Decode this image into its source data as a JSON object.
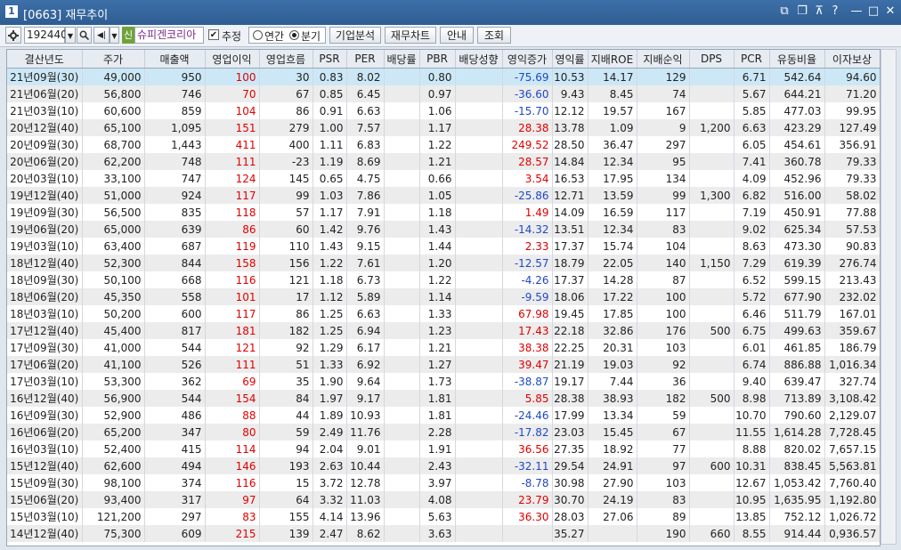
{
  "window": {
    "screen_no": "1",
    "title": "[0663] 재무추이",
    "controls": [
      "⧉",
      "❐",
      "⊼",
      "?",
      "—",
      "□",
      "✕"
    ]
  },
  "toolbar": {
    "code": "192440",
    "tag": "신",
    "company": "슈피겐코리아",
    "estimate_label": "추정",
    "estimate_checked": "✔",
    "radio_annual": "연간",
    "radio_quarter": "분기",
    "btn_company_analysis": "기업분석",
    "btn_fin_chart": "재무차트",
    "btn_guide": "안내",
    "btn_query": "조회"
  },
  "columns": [
    "결산년도",
    "주가",
    "매출액",
    "영업이익",
    "영업흐름",
    "PSR",
    "PER",
    "배당률",
    "PBR",
    "배당성향",
    "영익증가",
    "영익률",
    "지배ROE",
    "지배순익",
    "DPS",
    "PCR",
    "유동비율",
    "이자보상"
  ],
  "rows": [
    [
      "21년09월(30)",
      "49,000",
      "950",
      "100",
      "30",
      "0.83",
      "8.02",
      "",
      "0.80",
      "",
      "-75.69",
      "10.53",
      "14.17",
      "129",
      "",
      "6.71",
      "542.64",
      "94.60"
    ],
    [
      "21년06월(20)",
      "56,800",
      "746",
      "70",
      "67",
      "0.85",
      "6.45",
      "",
      "0.97",
      "",
      "-36.60",
      "9.43",
      "8.45",
      "74",
      "",
      "5.67",
      "644.21",
      "71.20"
    ],
    [
      "21년03월(10)",
      "60,600",
      "859",
      "104",
      "86",
      "0.91",
      "6.63",
      "",
      "1.06",
      "",
      "-15.70",
      "12.12",
      "19.57",
      "167",
      "",
      "5.85",
      "477.03",
      "99.95"
    ],
    [
      "20년12월(40)",
      "65,100",
      "1,095",
      "151",
      "279",
      "1.00",
      "7.57",
      "",
      "1.17",
      "",
      "28.38",
      "13.78",
      "1.09",
      "9",
      "1,200",
      "6.63",
      "423.29",
      "127.49"
    ],
    [
      "20년09월(30)",
      "68,700",
      "1,443",
      "411",
      "400",
      "1.11",
      "6.83",
      "",
      "1.22",
      "",
      "249.52",
      "28.50",
      "36.47",
      "297",
      "",
      "6.05",
      "454.61",
      "356.91"
    ],
    [
      "20년06월(20)",
      "62,200",
      "748",
      "111",
      "-23",
      "1.19",
      "8.69",
      "",
      "1.21",
      "",
      "28.57",
      "14.84",
      "12.34",
      "95",
      "",
      "7.41",
      "360.78",
      "79.33"
    ],
    [
      "20년03월(10)",
      "33,100",
      "747",
      "124",
      "145",
      "0.65",
      "4.75",
      "",
      "0.66",
      "",
      "3.54",
      "16.53",
      "17.95",
      "134",
      "",
      "4.09",
      "452.96",
      "79.33"
    ],
    [
      "19년12월(40)",
      "51,000",
      "924",
      "117",
      "99",
      "1.03",
      "7.86",
      "",
      "1.05",
      "",
      "-25.86",
      "12.71",
      "13.59",
      "99",
      "1,300",
      "6.82",
      "516.00",
      "58.02"
    ],
    [
      "19년09월(30)",
      "56,500",
      "835",
      "118",
      "57",
      "1.17",
      "7.91",
      "",
      "1.18",
      "",
      "1.49",
      "14.09",
      "16.59",
      "117",
      "",
      "7.19",
      "450.91",
      "77.88"
    ],
    [
      "19년06월(20)",
      "65,000",
      "639",
      "86",
      "60",
      "1.42",
      "9.76",
      "",
      "1.43",
      "",
      "-14.32",
      "13.51",
      "12.34",
      "83",
      "",
      "9.02",
      "625.34",
      "57.53"
    ],
    [
      "19년03월(10)",
      "63,400",
      "687",
      "119",
      "110",
      "1.43",
      "9.15",
      "",
      "1.44",
      "",
      "2.33",
      "17.37",
      "15.74",
      "104",
      "",
      "8.63",
      "473.30",
      "90.83"
    ],
    [
      "18년12월(40)",
      "52,300",
      "844",
      "158",
      "156",
      "1.22",
      "7.61",
      "",
      "1.20",
      "",
      "-12.57",
      "18.79",
      "22.05",
      "140",
      "1,150",
      "7.29",
      "619.39",
      "276.74"
    ],
    [
      "18년09월(30)",
      "50,100",
      "668",
      "116",
      "121",
      "1.18",
      "6.73",
      "",
      "1.22",
      "",
      "-4.26",
      "17.37",
      "14.28",
      "87",
      "",
      "6.52",
      "599.15",
      "213.43"
    ],
    [
      "18년06월(20)",
      "45,350",
      "558",
      "101",
      "17",
      "1.12",
      "5.89",
      "",
      "1.14",
      "",
      "-9.59",
      "18.06",
      "17.22",
      "100",
      "",
      "5.72",
      "677.90",
      "232.02"
    ],
    [
      "18년03월(10)",
      "50,200",
      "600",
      "117",
      "86",
      "1.25",
      "6.63",
      "",
      "1.33",
      "",
      "67.98",
      "19.45",
      "17.85",
      "100",
      "",
      "6.46",
      "511.79",
      "167.01"
    ],
    [
      "17년12월(40)",
      "45,400",
      "817",
      "181",
      "182",
      "1.25",
      "6.94",
      "",
      "1.23",
      "",
      "17.43",
      "22.18",
      "32.86",
      "176",
      "500",
      "6.75",
      "499.63",
      "359.67"
    ],
    [
      "17년09월(30)",
      "41,000",
      "544",
      "121",
      "92",
      "1.29",
      "6.17",
      "",
      "1.21",
      "",
      "38.38",
      "22.25",
      "20.31",
      "103",
      "",
      "6.01",
      "461.85",
      "186.79"
    ],
    [
      "17년06월(20)",
      "41,100",
      "526",
      "111",
      "51",
      "1.33",
      "6.92",
      "",
      "1.27",
      "",
      "39.47",
      "21.19",
      "19.03",
      "92",
      "",
      "6.74",
      "886.88",
      "1,016.34"
    ],
    [
      "17년03월(10)",
      "53,300",
      "362",
      "69",
      "35",
      "1.90",
      "9.64",
      "",
      "1.73",
      "",
      "-38.87",
      "19.17",
      "7.44",
      "36",
      "",
      "9.40",
      "639.47",
      "327.74"
    ],
    [
      "16년12월(40)",
      "56,900",
      "544",
      "154",
      "84",
      "1.97",
      "9.17",
      "",
      "1.81",
      "",
      "5.85",
      "28.38",
      "38.93",
      "182",
      "500",
      "8.98",
      "713.89",
      "3,108.42"
    ],
    [
      "16년09월(30)",
      "52,900",
      "486",
      "88",
      "44",
      "1.89",
      "10.93",
      "",
      "1.81",
      "",
      "-24.46",
      "17.99",
      "13.34",
      "59",
      "",
      "10.70",
      "790.60",
      "2,129.07"
    ],
    [
      "16년06월(20)",
      "65,200",
      "347",
      "80",
      "59",
      "2.49",
      "11.76",
      "",
      "2.28",
      "",
      "-17.82",
      "23.03",
      "15.45",
      "67",
      "",
      "11.55",
      "1,614.28",
      "7,728.45"
    ],
    [
      "16년03월(10)",
      "52,400",
      "415",
      "114",
      "94",
      "2.04",
      "9.01",
      "",
      "1.91",
      "",
      "36.56",
      "27.35",
      "18.92",
      "77",
      "",
      "8.88",
      "820.02",
      "7,657.15"
    ],
    [
      "15년12월(40)",
      "62,600",
      "494",
      "146",
      "193",
      "2.63",
      "10.44",
      "",
      "2.43",
      "",
      "-32.11",
      "29.54",
      "24.91",
      "97",
      "600",
      "10.31",
      "838.45",
      "5,563.81"
    ],
    [
      "15년09월(30)",
      "98,100",
      "374",
      "116",
      "15",
      "3.72",
      "12.78",
      "",
      "3.97",
      "",
      "-8.78",
      "30.98",
      "27.90",
      "103",
      "",
      "12.67",
      "1,053.42",
      "7,760.40"
    ],
    [
      "15년06월(20)",
      "93,400",
      "317",
      "97",
      "64",
      "3.32",
      "11.03",
      "",
      "4.08",
      "",
      "23.79",
      "30.70",
      "24.19",
      "83",
      "",
      "10.95",
      "1,635.95",
      "1,192.80"
    ],
    [
      "15년03월(10)",
      "121,200",
      "297",
      "83",
      "155",
      "4.14",
      "13.96",
      "",
      "5.63",
      "",
      "36.30",
      "28.03",
      "27.06",
      "89",
      "",
      "13.85",
      "752.12",
      "1,026.72"
    ],
    [
      "14년12월(40)",
      "75,300",
      "609",
      "215",
      "139",
      "2.47",
      "8.62",
      "",
      "3.63",
      "",
      "",
      "35.27",
      "",
      "190",
      "660",
      "8.55",
      "914.44",
      "0,936.57"
    ]
  ],
  "colors": {
    "positive": "#e00000",
    "negative": "#1f48c8",
    "selected_row": "#cce8f6"
  }
}
